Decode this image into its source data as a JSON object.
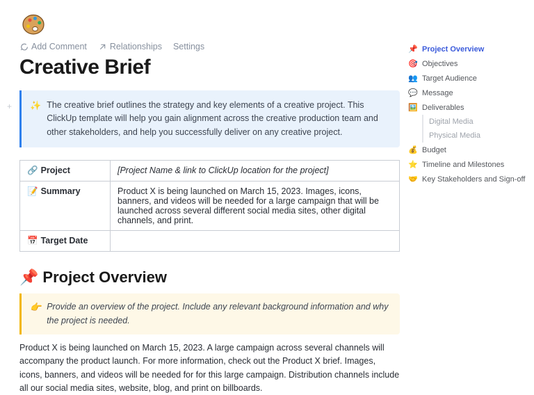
{
  "actions": {
    "add_comment": "Add Comment",
    "relationships": "Relationships",
    "settings": "Settings"
  },
  "title": "Creative Brief",
  "callout_intro": "The creative brief outlines the strategy and key elements of a creative project. This ClickUp template will help you gain alignment across the creative production team and other stakeholders, and help you successfully deliver on any creative project.",
  "table": {
    "rows": [
      {
        "icon": "🔗",
        "label": "Project",
        "value": "[Project Name & link to ClickUp location for the project]",
        "italic": true
      },
      {
        "icon": "📝",
        "label": "Summary",
        "value": "Product X is being launched on March 15, 2023. Images, icons, banners, and videos will be needed for a large campaign that will be launched across several different social media sites, other digital channels, and print.",
        "italic": false
      },
      {
        "icon": "📅",
        "label": "Target Date",
        "value": "",
        "italic": false
      }
    ]
  },
  "section_overview": {
    "icon": "📌",
    "title": "Project Overview",
    "hint_icon": "👉",
    "hint": "Provide an overview of the project. Include any relevant background information and why the project is needed.",
    "body": "Product X is being launched on March 15, 2023. A large campaign across several channels will accompany the product launch. For more information, check out the Product X brief. Images, icons, banners, and videos will be needed for for this large campaign. Distribution channels include all our social media sites, website, blog, and print on billboards."
  },
  "toc": [
    {
      "icon": "📌",
      "label": "Project Overview",
      "active": true
    },
    {
      "icon": "🎯",
      "label": "Objectives"
    },
    {
      "icon": "👥",
      "label": "Target Audience"
    },
    {
      "icon": "💬",
      "label": "Message"
    },
    {
      "icon": "🖼️",
      "label": "Deliverables",
      "children": [
        {
          "label": "Digital Media"
        },
        {
          "label": "Physical Media"
        }
      ]
    },
    {
      "icon": "💰",
      "label": "Budget"
    },
    {
      "icon": "⭐",
      "label": "Timeline and Milestones"
    },
    {
      "icon": "🤝",
      "label": "Key Stakeholders and Sign-off"
    }
  ]
}
